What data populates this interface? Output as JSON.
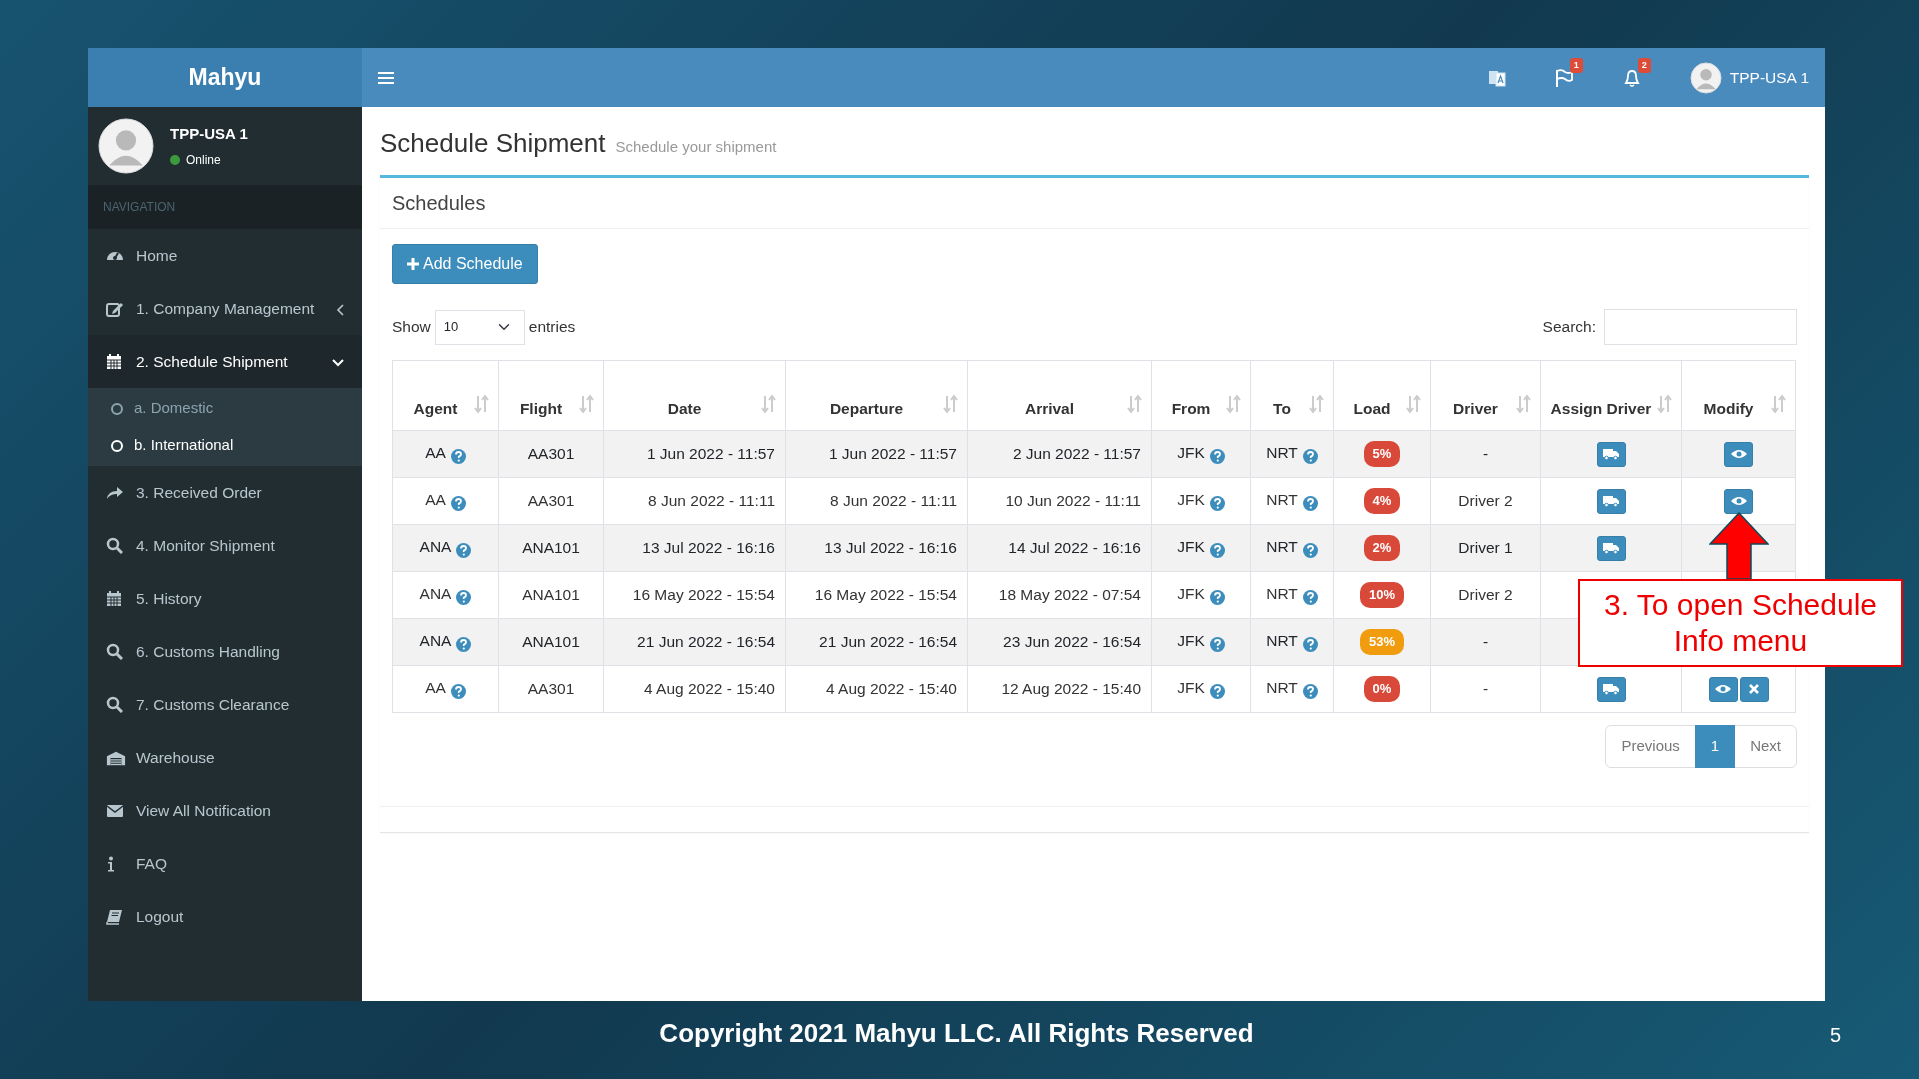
{
  "slide": {
    "copyright": "Copyright 2021 Mahyu LLC. All Rights Reserved",
    "page_number": "5"
  },
  "app": {
    "brand": "Mahyu",
    "user": {
      "name": "TPP-USA 1",
      "status": "Online"
    },
    "topbar": {
      "flag_count": "1",
      "bell_count": "2",
      "user_name": "TPP-USA 1"
    },
    "sidebar": {
      "header": "NAVIGATION",
      "items": [
        {
          "label": "Home",
          "kind": "dashboard",
          "selected": false
        },
        {
          "label": "1. Company Management",
          "kind": "edit",
          "selected": false,
          "expanded": false
        },
        {
          "label": "2. Schedule Shipment",
          "kind": "calendar",
          "selected": true,
          "expanded": true,
          "children": [
            {
              "label": "a. Domestic",
              "selected": false
            },
            {
              "label": "b. International",
              "selected": true
            }
          ]
        },
        {
          "label": "3. Received Order",
          "kind": "share",
          "selected": false
        },
        {
          "label": "4. Monitor Shipment",
          "kind": "search",
          "selected": false
        },
        {
          "label": "5. History",
          "kind": "calendar",
          "selected": false
        },
        {
          "label": "6. Customs Handling",
          "kind": "search",
          "selected": false
        },
        {
          "label": "7. Customs Clearance",
          "kind": "search",
          "selected": false
        },
        {
          "label": "Warehouse",
          "kind": "warehouse",
          "selected": false
        },
        {
          "label": "View All Notification",
          "kind": "envelope",
          "selected": false
        },
        {
          "label": "FAQ",
          "kind": "info",
          "selected": false
        },
        {
          "label": "Logout",
          "kind": "book",
          "selected": false
        }
      ]
    },
    "page": {
      "title": "Schedule Shipment",
      "subtitle": "Schedule your shipment",
      "box_title": "Schedules",
      "add_button": "Add Schedule",
      "length": {
        "before": "Show",
        "value": "10",
        "after": "entries"
      },
      "search_label": "Search:",
      "columns": [
        "Agent",
        "Flight",
        "Date",
        "Departure",
        "Arrival",
        "From",
        "To",
        "Load",
        "Driver",
        "Assign Driver",
        "Modify"
      ],
      "rows": [
        {
          "agent": "AA",
          "flight": "AA301",
          "date": "1 Jun 2022 - 11:57",
          "departure": "1 Jun 2022 - 11:57",
          "arrival": "2 Jun 2022 - 11:57",
          "from": "JFK",
          "to": "NRT",
          "load": {
            "text": "5%",
            "color": "#d9493a"
          },
          "driver": "-",
          "assign_button": true,
          "view_button": true,
          "delete_button": false
        },
        {
          "agent": "AA",
          "flight": "AA301",
          "date": "8 Jun 2022 - 11:11",
          "departure": "8 Jun 2022 - 11:11",
          "arrival": "10 Jun 2022 - 11:11",
          "from": "JFK",
          "to": "NRT",
          "load": {
            "text": "4%",
            "color": "#d9493a"
          },
          "driver": "Driver 2",
          "assign_button": true,
          "view_button": true,
          "delete_button": false
        },
        {
          "agent": "ANA",
          "flight": "ANA101",
          "date": "13 Jul 2022 - 16:16",
          "departure": "13 Jul 2022 - 16:16",
          "arrival": "14 Jul 2022 - 16:16",
          "from": "JFK",
          "to": "NRT",
          "load": {
            "text": "2%",
            "color": "#d9493a"
          },
          "driver": "Driver 1",
          "assign_button": true,
          "view_button": false,
          "delete_button": false
        },
        {
          "agent": "ANA",
          "flight": "ANA101",
          "date": "16 May 2022 - 15:54",
          "departure": "16 May 2022 - 15:54",
          "arrival": "18 May 2022 - 07:54",
          "from": "JFK",
          "to": "NRT",
          "load": {
            "text": "10%",
            "color": "#d9493a"
          },
          "driver": "Driver 2",
          "assign_button": false,
          "view_button": false,
          "delete_button": false
        },
        {
          "agent": "ANA",
          "flight": "ANA101",
          "date": "21 Jun 2022 - 16:54",
          "departure": "21 Jun 2022 - 16:54",
          "arrival": "23 Jun 2022 - 16:54",
          "from": "JFK",
          "to": "NRT",
          "load": {
            "text": "53%",
            "color": "#f09c0e"
          },
          "driver": "-",
          "assign_button": false,
          "view_button": false,
          "delete_button": false
        },
        {
          "agent": "AA",
          "flight": "AA301",
          "date": "4 Aug 2022 - 15:40",
          "departure": "4 Aug 2022 - 15:40",
          "arrival": "12 Aug 2022 - 15:40",
          "from": "JFK",
          "to": "NRT",
          "load": {
            "text": "0%",
            "color": "#d9493a"
          },
          "driver": "-",
          "assign_button": true,
          "view_button": true,
          "delete_button": true
        }
      ],
      "pagination": [
        {
          "label": "Previous",
          "selected": false
        },
        {
          "label": "1",
          "selected": true
        },
        {
          "label": "Next",
          "selected": false
        }
      ]
    }
  },
  "annotation": {
    "text": "3. To open Schedule Info menu"
  }
}
